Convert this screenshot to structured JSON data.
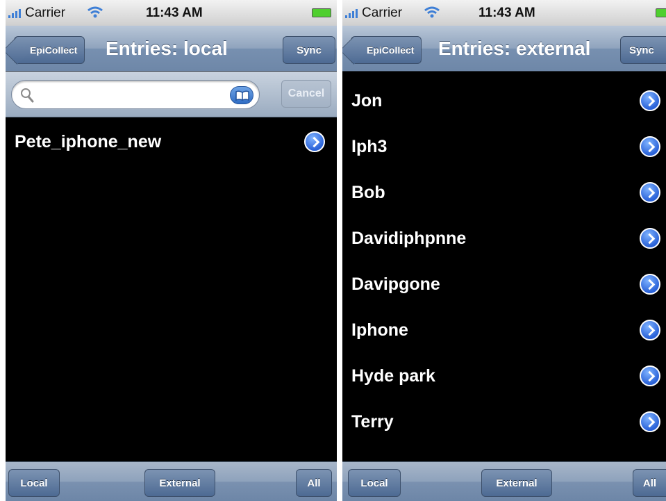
{
  "colors": {
    "nav_bar": "#7790b0",
    "disclosure_accent": "#2a62d8",
    "list_background": "#000000",
    "list_text": "#ffffff"
  },
  "left_screen": {
    "status_bar": {
      "carrier": "Carrier",
      "time": "11:43 AM"
    },
    "nav": {
      "back_label": "EpiCollect",
      "title": "Entries: local",
      "sync_label": "Sync"
    },
    "search": {
      "placeholder": "",
      "cancel_label": "Cancel"
    },
    "entries": [
      {
        "label": "Pete_iphone_new"
      }
    ],
    "toolbar": {
      "local_label": "Local",
      "external_label": "External",
      "all_label": "All"
    }
  },
  "right_screen": {
    "status_bar": {
      "carrier": "Carrier",
      "time": "11:43 AM"
    },
    "nav": {
      "back_label": "EpiCollect",
      "title": "Entries: external",
      "sync_label": "Sync"
    },
    "entries": [
      {
        "label": "Jon"
      },
      {
        "label": "Iph3"
      },
      {
        "label": "Bob"
      },
      {
        "label": "Davidiphpnne"
      },
      {
        "label": "Davipgone"
      },
      {
        "label": "Iphone"
      },
      {
        "label": "Hyde park"
      },
      {
        "label": "Terry"
      }
    ],
    "toolbar": {
      "local_label": "Local",
      "external_label": "External",
      "all_label": "All"
    }
  }
}
